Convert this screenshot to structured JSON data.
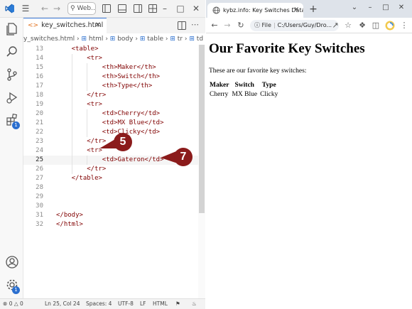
{
  "vscode": {
    "command_center": "Web...",
    "tab_label": "key_switches.html",
    "breadcrumb": {
      "file": "y_switches.html",
      "items": [
        "html",
        "body",
        "table",
        "tr",
        "td"
      ]
    },
    "lines": [
      {
        "n": "13",
        "code": "<table>",
        "indent": 1
      },
      {
        "n": "14",
        "code": "<tr>",
        "indent": 2
      },
      {
        "n": "15",
        "code": "<th>Maker</th>",
        "indent": 3
      },
      {
        "n": "16",
        "code": "<th>Switch</th>",
        "indent": 3
      },
      {
        "n": "17",
        "code": "<th>Type</th>",
        "indent": 3
      },
      {
        "n": "18",
        "code": "</tr>",
        "indent": 2
      },
      {
        "n": "19",
        "code": "<tr>",
        "indent": 2
      },
      {
        "n": "20",
        "code": "<td>Cherry</td>",
        "indent": 3
      },
      {
        "n": "21",
        "code": "<td>MX Blue</td>",
        "indent": 3
      },
      {
        "n": "22",
        "code": "<td>Clicky</td>",
        "indent": 3
      },
      {
        "n": "23",
        "code": "</tr>",
        "indent": 2
      },
      {
        "n": "24",
        "code": "<tr>",
        "indent": 2
      },
      {
        "n": "25",
        "code": "<td>Gateron</td>",
        "indent": 3,
        "active": true
      },
      {
        "n": "26",
        "code": "</tr>",
        "indent": 2
      },
      {
        "n": "27",
        "code": "</table>",
        "indent": 1
      },
      {
        "n": "28",
        "code": "",
        "indent": 0
      },
      {
        "n": "29",
        "code": "",
        "indent": 0
      },
      {
        "n": "30",
        "code": "",
        "indent": 0
      },
      {
        "n": "31",
        "code": "</body>",
        "indent": 0
      },
      {
        "n": "32",
        "code": "</html>",
        "indent": 0
      }
    ],
    "status": {
      "errors": "0",
      "warnings": "0",
      "position": "Ln 25, Col 24",
      "spaces": "Spaces: 4",
      "encoding": "UTF-8",
      "eol": "LF",
      "language": "HTML"
    },
    "badges": {
      "extensions": "1",
      "settings": "1"
    }
  },
  "chrome": {
    "tab_title": "kybz.info: Key Switches Data",
    "new_tab": "+",
    "omnibox_label": "File",
    "omnibox_url": "C:/Users/Guy/Dro...",
    "page": {
      "heading": "Our Favorite Key Switches",
      "paragraph": "These are our favorite key switches:",
      "table_headers": [
        "Maker",
        "Switch",
        "Type"
      ],
      "table_rows": [
        [
          "Cherry",
          "MX Blue",
          "Clicky"
        ]
      ]
    }
  },
  "callouts": [
    "5",
    "7"
  ],
  "colors": {
    "tag": "#800000",
    "accent": "#3c7ad6",
    "callout": "#8b1b1b",
    "badge": "#2b6fcf"
  }
}
